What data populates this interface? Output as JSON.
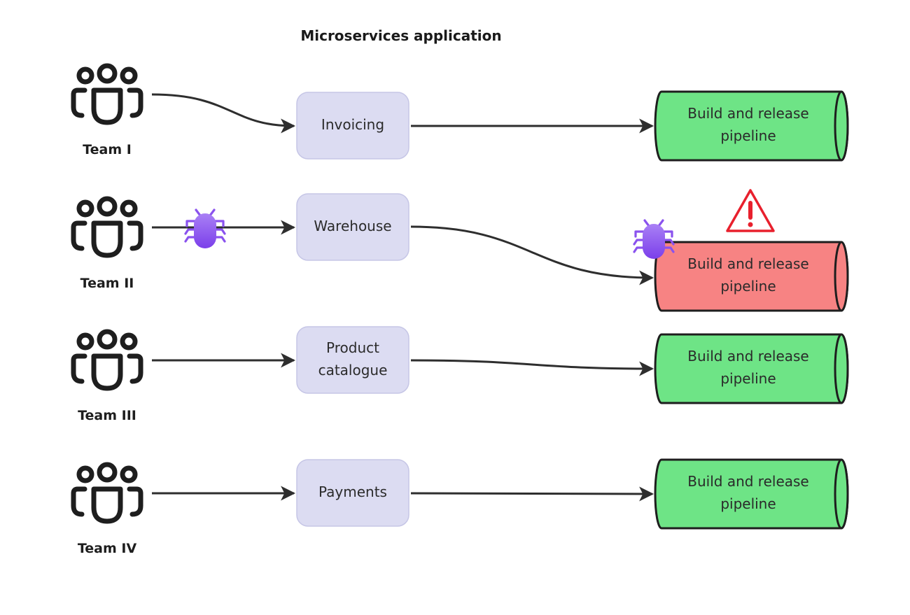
{
  "title": "Microservices application",
  "colors": {
    "service_fill": "#dcdcf2",
    "service_stroke": "#c6c6e6",
    "pipeline_ok": "#6ee486",
    "pipeline_error": "#f78383",
    "bug": "#8a52ee",
    "warning": "#e8202d",
    "arrow": "#2e2e2e",
    "icon": "#1e1e1e"
  },
  "rows": [
    {
      "team": "Team I",
      "service": [
        "Invoicing"
      ],
      "pipeline": [
        "Build and release",
        "pipeline"
      ],
      "status": "ok",
      "bug_on_team_link": false,
      "bug_on_pipeline": false,
      "warning": false
    },
    {
      "team": "Team II",
      "service": [
        "Warehouse"
      ],
      "pipeline": [
        "Build and release",
        "pipeline"
      ],
      "status": "error",
      "bug_on_team_link": true,
      "bug_on_pipeline": true,
      "warning": true
    },
    {
      "team": "Team III",
      "service": [
        "Product",
        "catalogue"
      ],
      "pipeline": [
        "Build and release",
        "pipeline"
      ],
      "status": "ok",
      "bug_on_team_link": false,
      "bug_on_pipeline": false,
      "warning": false
    },
    {
      "team": "Team IV",
      "service": [
        "Payments"
      ],
      "pipeline": [
        "Build and release",
        "pipeline"
      ],
      "status": "ok",
      "bug_on_team_link": false,
      "bug_on_pipeline": false,
      "warning": false
    }
  ],
  "icons": {
    "team": "team-people-icon",
    "bug": "bug-icon",
    "warning": "warning-triangle-icon"
  }
}
